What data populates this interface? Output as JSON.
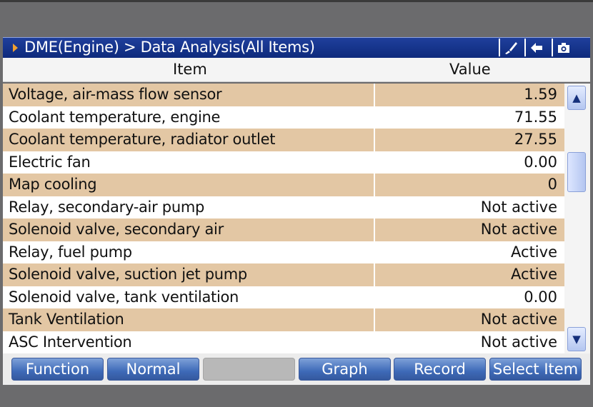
{
  "titlebar": {
    "title": "DME(Engine) > Data Analysis(All Items)",
    "icons": [
      "brush-icon",
      "back-arrow-icon",
      "camera-icon"
    ]
  },
  "table": {
    "headers": {
      "item": "Item",
      "value": "Value"
    },
    "rows": [
      {
        "item": "Voltage, air-mass flow sensor",
        "value": "1.59"
      },
      {
        "item": "Coolant temperature, engine",
        "value": "71.55"
      },
      {
        "item": "Coolant temperature, radiator outlet",
        "value": "27.55"
      },
      {
        "item": "Electric fan",
        "value": "0.00"
      },
      {
        "item": "Map cooling",
        "value": "0"
      },
      {
        "item": "Relay, secondary-air pump",
        "value": "Not active"
      },
      {
        "item": "Solenoid valve, secondary air",
        "value": "Not active"
      },
      {
        "item": "Relay, fuel pump",
        "value": "Active"
      },
      {
        "item": "Solenoid valve, suction jet pump",
        "value": "Active"
      },
      {
        "item": "Solenoid valve, tank ventilation",
        "value": "0.00"
      },
      {
        "item": "Tank Ventilation",
        "value": "Not active"
      },
      {
        "item": "ASC Intervention",
        "value": "Not active"
      }
    ]
  },
  "footer": {
    "buttons": [
      "Function",
      "Normal",
      "",
      "Graph",
      "Record",
      "Select Item"
    ]
  },
  "colors": {
    "titlebar": "#0e2a7c",
    "row_shade": "#e3c7a4",
    "button": "#3e6ab8"
  }
}
